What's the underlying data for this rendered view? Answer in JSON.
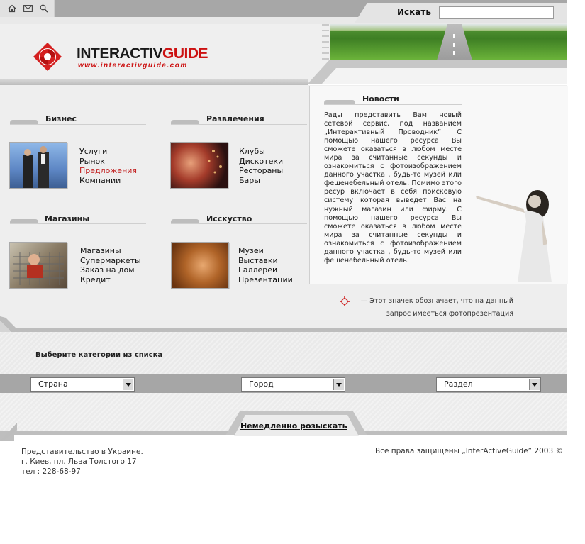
{
  "top_icons": [
    "home-icon",
    "mail-icon",
    "search-icon"
  ],
  "search": {
    "link_label": "Искать",
    "value": ""
  },
  "logo": {
    "name_part1": "INTERACTIV",
    "name_part2": "GUIDE",
    "url": "www.interactivguide.com"
  },
  "sections": [
    {
      "title": "Бизнес",
      "links": [
        "Услуги",
        "Рынок",
        "Предложения",
        "Компании"
      ],
      "active_index": 2
    },
    {
      "title": "Развлечения",
      "links": [
        "Клубы",
        "Дискотеки",
        "Рестораны",
        "Бары"
      ]
    },
    {
      "title": "Магазины",
      "links": [
        "Магазины",
        "Супермаркеты",
        "Заказ на дом",
        "Кредит"
      ]
    },
    {
      "title": "Исскуство",
      "links": [
        "Музеи",
        "Выставки",
        "Галлереи",
        "Презентации"
      ]
    }
  ],
  "news": {
    "title": "Новости",
    "text": "Рады представить Вам новый сетевой сервис, под названием „Интерактивный Проводник”. С помощью нашего ресурса Вы сможете оказаться в любом месте мира за считанные секунды и ознакомиться с фотоизображением данного участка , будь-то музей или фешенебельный отель. Помимо этого ресур включает в себя поисковую систему которая выведет Вас на нужный магазин или фирму. С помощью нашего ресурса Вы сможете оказаться в любом месте мира за считанные секунды и ознакомиться с фотоизображением данного участка , будь-то музей или фешенебельный отель."
  },
  "legend": {
    "line1": "— Этот значек обозначает, что на данный",
    "line2": "запрос имееться фотопрезентация"
  },
  "category": {
    "label": "Выберите категории из списка",
    "selects": [
      {
        "value": "Страна"
      },
      {
        "value": "Город"
      },
      {
        "value": "Раздел"
      }
    ]
  },
  "action": {
    "label": "Немедленно розыскать"
  },
  "footer": {
    "address": [
      "Представительство в Украине.",
      "г. Киев, пл. Льва Толстого 17",
      "тел : 228-68-97"
    ],
    "copyright": "Все права защищены „InterActiveGuide”  2003 ©"
  },
  "colors": {
    "accent": "#cc1111",
    "link_active": "#c21f1f",
    "bar_gray": "#a6a6a6"
  }
}
